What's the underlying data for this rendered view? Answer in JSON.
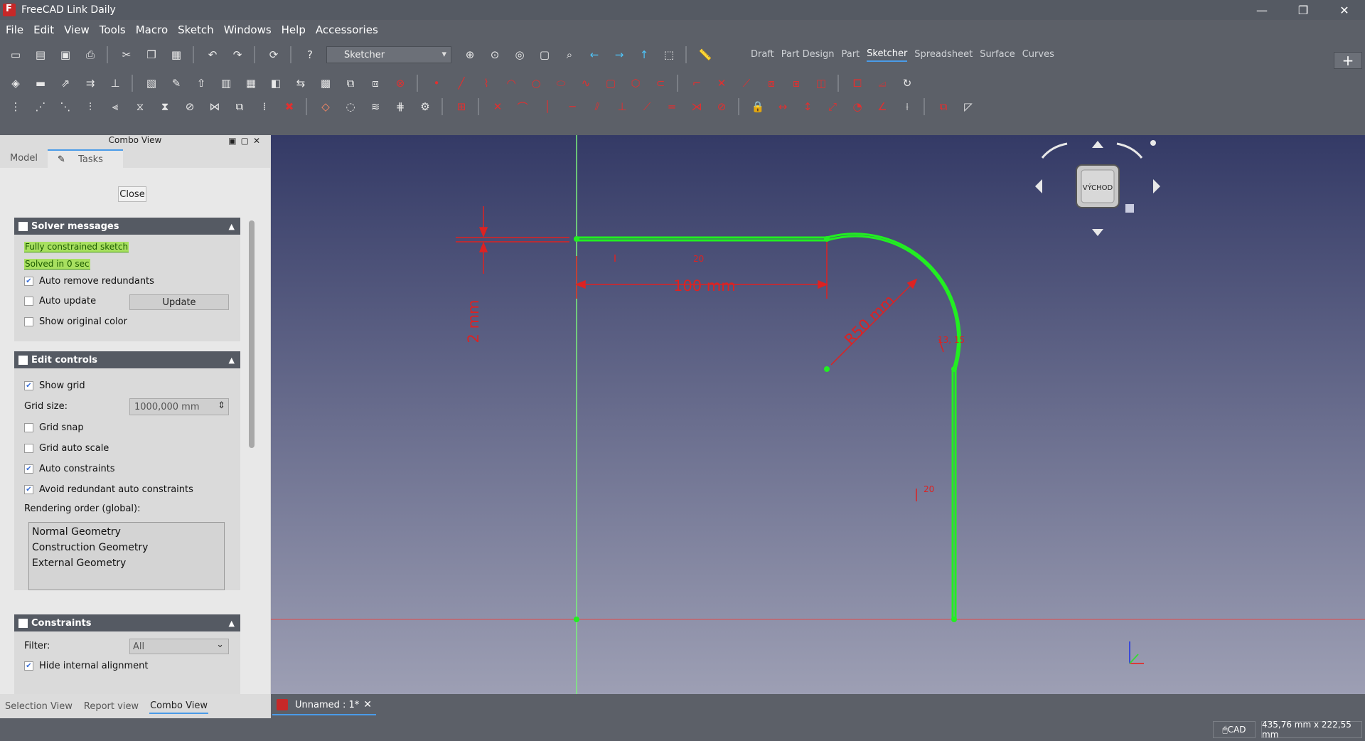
{
  "window": {
    "title": "FreeCAD Link Daily",
    "minimize": "—",
    "maximize": "❐",
    "close": "✕"
  },
  "menu": [
    "File",
    "Edit",
    "View",
    "Tools",
    "Macro",
    "Sketch",
    "Windows",
    "Help",
    "Accessories"
  ],
  "toolbar": {
    "workbench_selector": "Sketcher",
    "workbenches": [
      "Draft",
      "Part Design",
      "Part",
      "Sketcher",
      "Spreadsheet",
      "Surface",
      "Curves"
    ],
    "active_workbench": "Sketcher",
    "plus": "+"
  },
  "combo": {
    "title": "Combo View",
    "tabs": [
      "Model",
      "Tasks"
    ],
    "active_tab": "Tasks",
    "close_label": "Close"
  },
  "solver": {
    "header": "Solver messages",
    "status1": "Fully constrained sketch",
    "status2": "Solved in 0 sec",
    "auto_remove_redundants": "Auto remove redundants",
    "auto_update": "Auto update",
    "update_button": "Update",
    "show_original_color": "Show original color"
  },
  "edit_controls": {
    "header": "Edit controls",
    "show_grid": "Show grid",
    "grid_size_label": "Grid size:",
    "grid_size_value": "1000,000 mm",
    "grid_snap": "Grid snap",
    "grid_auto_scale": "Grid auto scale",
    "auto_constraints": "Auto constraints",
    "avoid_redundant": "Avoid redundant auto constraints",
    "rendering_order_label": "Rendering order (global):",
    "rendering_order": [
      "Normal Geometry",
      "Construction Geometry",
      "External Geometry"
    ]
  },
  "constraints": {
    "header": "Constraints",
    "filter_label": "Filter:",
    "filter_value": "All",
    "hide_internal": "Hide internal alignment"
  },
  "bottom_tabs": [
    "Selection View",
    "Report view",
    "Combo View"
  ],
  "active_bottom_tab": "Combo View",
  "sketch": {
    "dim_length": "100 mm",
    "dim_radius": "R50 mm",
    "dim_thickness": "2 mm",
    "constraint_a": "20",
    "constraint_b": "20",
    "constraint_c": "13, 15",
    "navcube_face": "VÝCHOD"
  },
  "document_tab": "Unnamed : 1*",
  "status": {
    "nav_style": "CAD",
    "coordinates": "435,76 mm x 222,55 mm"
  },
  "colors": {
    "sketch_green": "#22ee22",
    "dimension_red": "#dd2222",
    "viewport_top": "#343a66",
    "viewport_bottom": "#9d9fb4"
  }
}
